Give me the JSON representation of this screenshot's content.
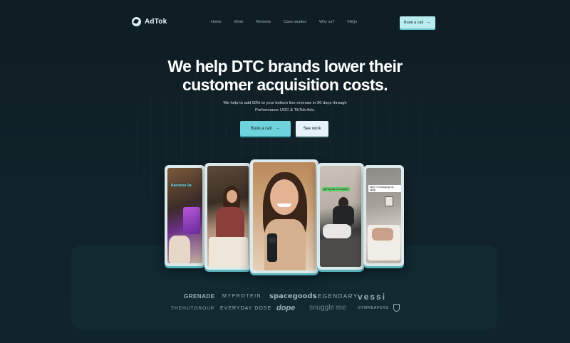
{
  "brand": {
    "name": "AdTok",
    "logo_icon": "adtok-logo-icon"
  },
  "nav": {
    "items": [
      "Home",
      "Work",
      "Reviews",
      "Case studies",
      "Why us?",
      "FAQs"
    ]
  },
  "header_cta": {
    "label": "Book a call",
    "icon": "arrow-right-icon"
  },
  "hero": {
    "title": "We help DTC brands lower their customer acquisition costs.",
    "subtitle": "We help to add 50% to your bottom line revenue in 90 days through Performance UGC & TikTok Ads.",
    "primary_button": "Book a call",
    "secondary_button": "See work"
  },
  "videos": {
    "card1_caption": "Rainbow Da",
    "card2_caption": "",
    "card4_caption": "get my fav to compare",
    "card5_caption": "Why I'm changing my sleep"
  },
  "brands": {
    "row1": [
      "GRENADE",
      "MYPROTEIN",
      "spacegoods",
      "LEGENDARY",
      "vessi"
    ],
    "row2": [
      "THEHUTGROUP",
      "EVERYDAY DOSE",
      "dope",
      "snuggle me",
      "GYMREAPERS"
    ]
  },
  "colors": {
    "background": "#0e1c21",
    "accent": "#6fd3dd",
    "accent_light": "#b9ecef",
    "panel": "#112931",
    "muted_text": "#9fb6bb"
  }
}
